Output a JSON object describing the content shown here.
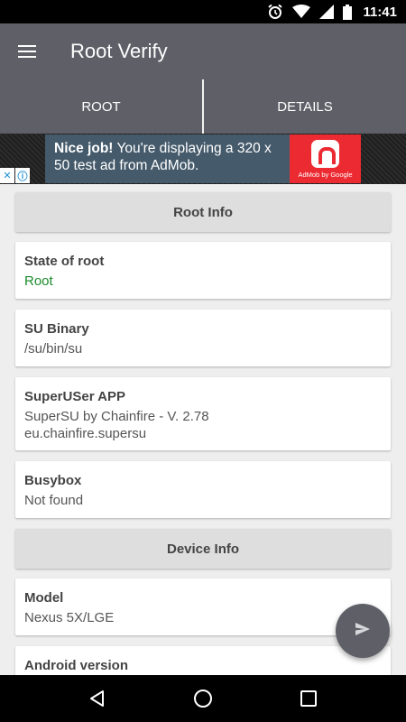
{
  "status_bar": {
    "time": "11:41",
    "icons": [
      "alarm-icon",
      "wifi-icon",
      "signal-icon",
      "battery-icon"
    ]
  },
  "app_bar": {
    "title": "Root Verify",
    "menu_icon": "hamburger-menu-icon"
  },
  "tabs": [
    {
      "label": "ROOT"
    },
    {
      "label": "DETAILS"
    }
  ],
  "ad": {
    "headline": "Nice job!",
    "body": " You're displaying a 320 x 50 test ad from AdMob.",
    "logo_tag": "AdMob by Google",
    "close_icon": "close-icon",
    "info_icon": "info-icon"
  },
  "sections": {
    "root_info": "Root Info",
    "device_info": "Device Info"
  },
  "cards": {
    "state_of_root": {
      "title": "State of root",
      "value": "Root"
    },
    "su_binary": {
      "title": "SU Binary",
      "value": "/su/bin/su"
    },
    "superuser_app": {
      "title": "SuperUSer APP",
      "value": "SuperSU by Chainfire - V. 2.78",
      "value2": "eu.chainfire.supersu"
    },
    "busybox": {
      "title": "Busybox",
      "value": "Not found"
    },
    "model": {
      "title": "Model",
      "value": "Nexus 5X/LGE"
    },
    "android_version": {
      "title": "Android version"
    }
  },
  "fab": {
    "icon": "send-icon"
  },
  "nav_bar": {
    "icons": [
      "back-icon",
      "home-icon",
      "recents-icon"
    ]
  },
  "colors": {
    "primary": "#5f5f68",
    "root_green": "#1b8a2a",
    "admob_red": "#ec2a32",
    "ad_panel": "#455a6b"
  }
}
